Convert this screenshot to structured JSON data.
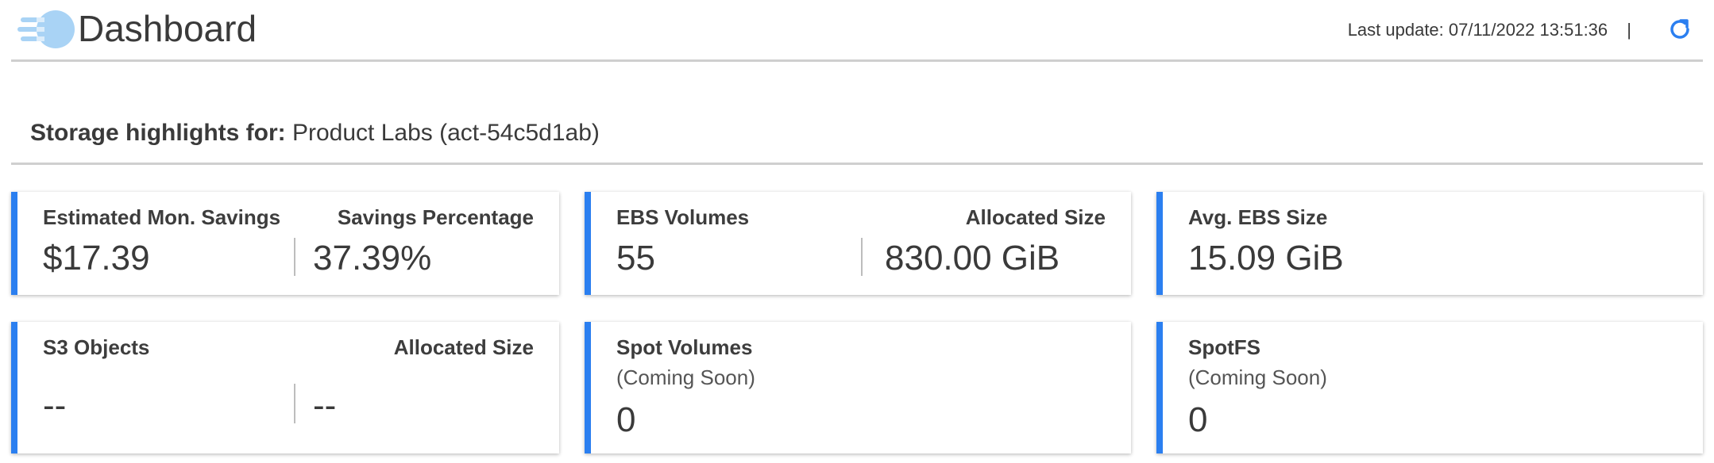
{
  "header": {
    "title": "Dashboard",
    "last_update_label": "Last update:",
    "last_update_value": "07/11/2022 13:51:36",
    "separator": "|",
    "icons": {
      "logo": "app-logo",
      "refresh": "refresh-icon"
    },
    "accent_color": "#2b7ff0"
  },
  "highlights": {
    "label": "Storage highlights for:",
    "account": "Product Labs (act-54c5d1ab)"
  },
  "cards": {
    "savings": {
      "left_label": "Estimated Mon. Savings",
      "left_value": "$17.39",
      "right_label": "Savings Percentage",
      "right_value": "37.39%"
    },
    "ebs": {
      "left_label": "EBS Volumes",
      "left_value": "55",
      "right_label": "Allocated Size",
      "right_value": "830.00 GiB"
    },
    "avg_ebs": {
      "label": "Avg. EBS Size",
      "value": "15.09 GiB"
    },
    "s3": {
      "left_label": "S3 Objects",
      "left_value": "--",
      "right_label": "Allocated Size",
      "right_value": "--"
    },
    "spot_volumes": {
      "label": "Spot Volumes",
      "note": "(Coming Soon)",
      "value": "0"
    },
    "spotfs": {
      "label": "SpotFS",
      "note": "(Coming Soon)",
      "value": "0"
    }
  }
}
